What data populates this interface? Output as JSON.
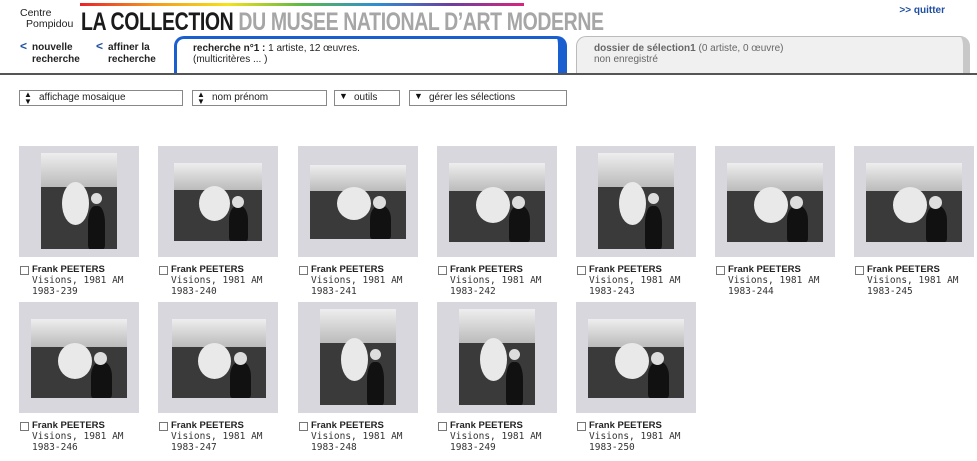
{
  "header": {
    "brand_line1": "Centre",
    "brand_line2": "Pompidou",
    "title_dark": "LA COLLECTION",
    "title_grey": "DU MUSEE NATIONAL D’ART MODERNE",
    "quit_label": ">> quitter"
  },
  "nav": {
    "new_search_line1": "nouvelle",
    "new_search_line2": "recherche",
    "refine_line1": "affiner la",
    "refine_line2": "recherche",
    "arrow": "<"
  },
  "tabs": {
    "active": {
      "label_bold": "recherche n°1 :",
      "summary": " 1 artiste, 12 œuvres.",
      "line2": "(multicritères ... )"
    },
    "inactive": {
      "label_bold": "dossier de sélection1",
      "summary": " (0 artiste, 0 œuvre)",
      "line2": "non enregistré"
    }
  },
  "toolbar": {
    "display_mode": "affichage mosaique",
    "sort": "nom prénom",
    "tools": "outils",
    "selections": "gérer les sélections"
  },
  "results": [
    {
      "artist": "Frank PEETERS",
      "work": "Visions, 1981 AM",
      "inv": "1983-239"
    },
    {
      "artist": "Frank PEETERS",
      "work": "Visions, 1981 AM",
      "inv": "1983-240"
    },
    {
      "artist": "Frank PEETERS",
      "work": "Visions, 1981 AM",
      "inv": "1983-241"
    },
    {
      "artist": "Frank PEETERS",
      "work": "Visions, 1981 AM",
      "inv": "1983-242"
    },
    {
      "artist": "Frank PEETERS",
      "work": "Visions, 1981 AM",
      "inv": "1983-243"
    },
    {
      "artist": "Frank PEETERS",
      "work": "Visions, 1981 AM",
      "inv": "1983-244"
    },
    {
      "artist": "Frank PEETERS",
      "work": "Visions, 1981 AM",
      "inv": "1983-245"
    },
    {
      "artist": "Frank PEETERS",
      "work": "Visions, 1981 AM",
      "inv": "1983-246"
    },
    {
      "artist": "Frank PEETERS",
      "work": "Visions, 1981 AM",
      "inv": "1983-247"
    },
    {
      "artist": "Frank PEETERS",
      "work": "Visions, 1981 AM",
      "inv": "1983-248"
    },
    {
      "artist": "Frank PEETERS",
      "work": "Visions, 1981 AM",
      "inv": "1983-249"
    },
    {
      "artist": "Frank PEETERS",
      "work": "Visions, 1981 AM",
      "inv": "1983-250"
    }
  ]
}
